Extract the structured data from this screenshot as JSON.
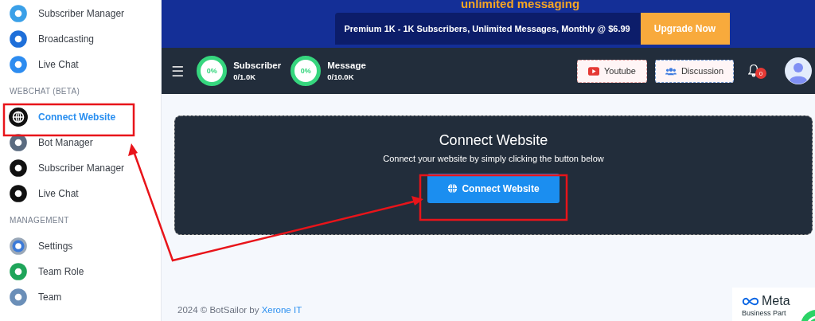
{
  "sidebar": {
    "groups": [
      {
        "items": [
          {
            "label": "Subscriber Manager",
            "selected": false
          },
          {
            "label": "Broadcasting",
            "selected": false
          },
          {
            "label": "Live Chat",
            "selected": false
          }
        ]
      },
      {
        "heading": "WEBCHAT (BETA)",
        "items": [
          {
            "label": "Connect Website",
            "selected": true
          },
          {
            "label": "Bot Manager",
            "selected": false
          },
          {
            "label": "Subscriber Manager",
            "selected": false
          },
          {
            "label": "Live Chat",
            "selected": false
          }
        ]
      },
      {
        "heading": "MANAGEMENT",
        "items": [
          {
            "label": "Settings",
            "selected": false
          },
          {
            "label": "Team Role",
            "selected": false
          },
          {
            "label": "Team",
            "selected": false
          }
        ]
      }
    ]
  },
  "banner": {
    "headline": "unlimited messaging",
    "plan": "Premium 1K - 1K Subscribers, Unlimited Messages, Monthly @ $6.99",
    "upgrade": "Upgrade Now"
  },
  "header": {
    "menu": "☰",
    "usage": [
      {
        "percent": "0%",
        "label": "Subscriber",
        "count": "0/1.0K"
      },
      {
        "percent": "0%",
        "label": "Message",
        "count": "0/10.0K"
      }
    ],
    "buttons": [
      {
        "kind": "youtube",
        "label": "Youtube"
      },
      {
        "kind": "discussion",
        "label": "Discussion"
      }
    ],
    "notifications": "0"
  },
  "card": {
    "title": "Connect Website",
    "text": "Connect your website by simply clicking the button below",
    "button": "Connect Website"
  },
  "footer": {
    "text": "2024 © BotSailor by ",
    "link": "Xerone IT"
  },
  "partner": {
    "brand": "Meta",
    "caption": "Business Part"
  }
}
